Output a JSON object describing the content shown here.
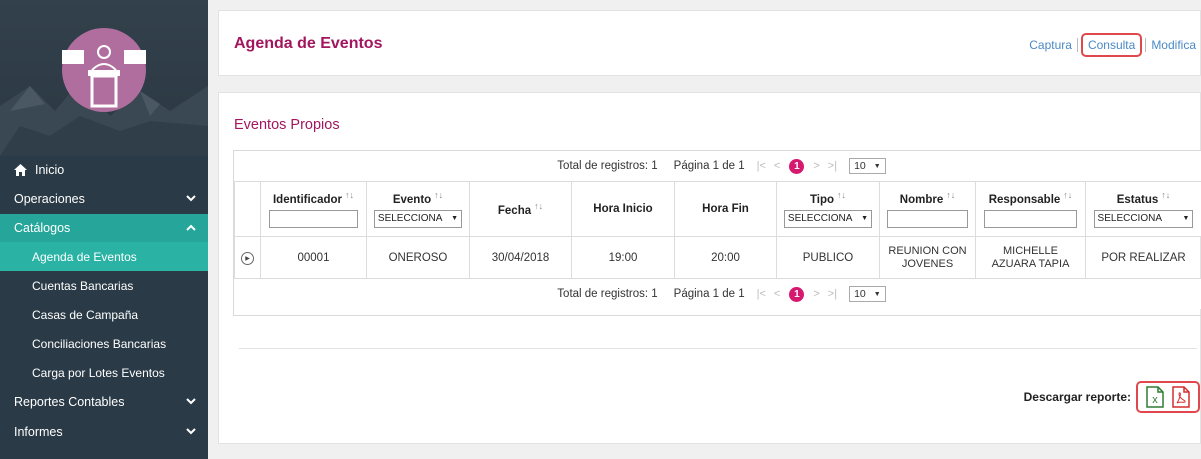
{
  "sidebar": {
    "items": [
      {
        "label": "Inicio"
      },
      {
        "label": "Operaciones"
      },
      {
        "label": "Catálogos"
      },
      {
        "label": "Reportes Contables"
      },
      {
        "label": "Informes"
      }
    ],
    "submenu": [
      {
        "label": "Agenda de Eventos"
      },
      {
        "label": "Cuentas Bancarias"
      },
      {
        "label": "Casas de Campaña"
      },
      {
        "label": "Conciliaciones Bancarias"
      },
      {
        "label": "Carga por Lotes Eventos"
      }
    ]
  },
  "header": {
    "title": "Agenda de Eventos",
    "links": [
      "Captura",
      "Consulta",
      "Modifica"
    ]
  },
  "main": {
    "section_title": "Eventos Propios",
    "pager": {
      "total": "Total de registros: 1",
      "page": "Página 1 de 1",
      "current": "1",
      "page_size": "10"
    },
    "columns": [
      "Identificador",
      "Evento",
      "Fecha",
      "Hora Inicio",
      "Hora Fin",
      "Tipo",
      "Nombre",
      "Responsable",
      "Estatus"
    ],
    "filters": {
      "evento": "SELECCIONA",
      "tipo": "SELECCIONA",
      "estatus": "SELECCIONA"
    },
    "rows": [
      [
        "00001",
        "ONEROSO",
        "30/04/2018",
        "19:00",
        "20:00",
        "PUBLICO",
        "REUNION CON JOVENES",
        "MICHELLE AZUARA TAPIA",
        "POR REALIZAR"
      ]
    ],
    "download_label": "Descargar reporte:"
  },
  "colors": {
    "sidebar": "#2a3a46",
    "active_menu": "#26a69a",
    "title": "#a3165f",
    "highlight_box": "#e0484d",
    "page_dot": "#d6196e"
  }
}
